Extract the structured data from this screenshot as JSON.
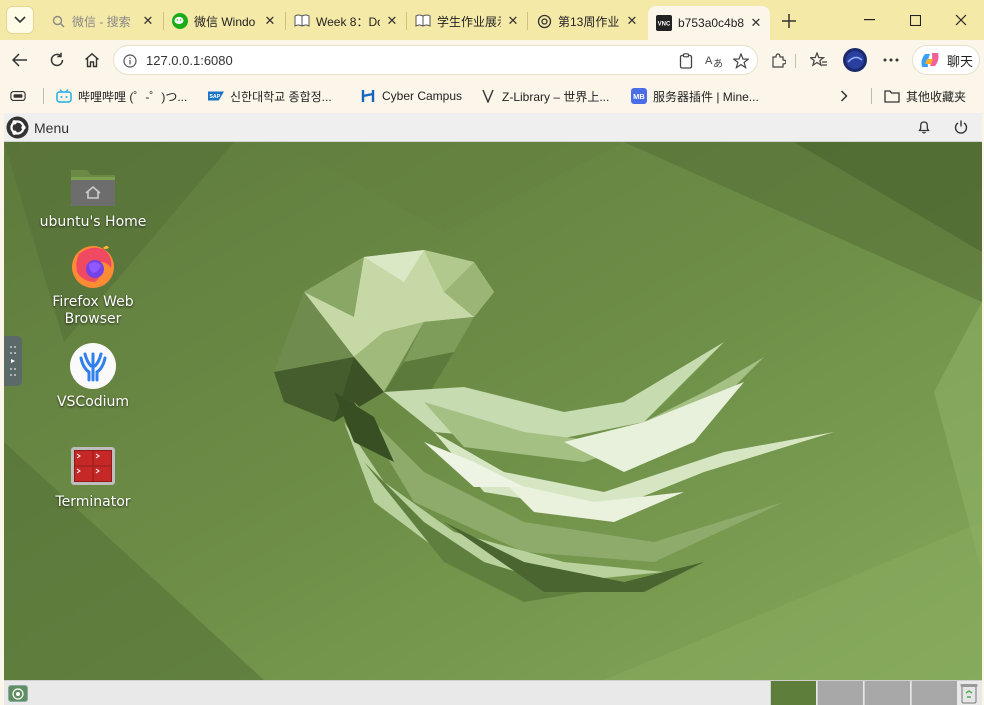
{
  "browser": {
    "tabs": [
      {
        "title": "微信 - 搜索",
        "icon": "search-icon",
        "faded": true
      },
      {
        "title": "微信 Windo",
        "icon": "wechat-icon"
      },
      {
        "title": "Week 8：Do",
        "icon": "book-icon"
      },
      {
        "title": "学生作业展示",
        "icon": "book-icon"
      },
      {
        "title": "第13周作业",
        "icon": "chatgpt-icon"
      },
      {
        "title": "b753a0c4b8",
        "icon": "vnc-icon",
        "active": true
      }
    ],
    "address": {
      "url": "127.0.0.1:6080"
    },
    "chat_label": "聊天",
    "bookmarks": [
      {
        "label": "哔哩哔哩 (゜-゜)つ...",
        "icon": "bilibili-icon"
      },
      {
        "label": "신한대학교 종합정...",
        "icon": "sap-icon"
      },
      {
        "label": "Cyber Campus",
        "icon": "cybercampus-icon"
      },
      {
        "label": "Z-Library – 世界上...",
        "icon": "zlibrary-icon"
      },
      {
        "label": "服务器插件 | Mine...",
        "icon": "mb-icon"
      }
    ],
    "other_bookmarks": "其他收藏夹",
    "mb_badge": "MB",
    "vnc_badge": "VNC",
    "sap_badge": "SAP"
  },
  "desktop": {
    "menu_label": "Menu",
    "icons": [
      {
        "label": "ubuntu's Home",
        "icon": "home-folder-icon"
      },
      {
        "label": "Firefox Web Browser",
        "icon": "firefox-icon"
      },
      {
        "label": "VSCodium",
        "icon": "vscodium-icon"
      },
      {
        "label": "Terminator",
        "icon": "terminator-icon"
      }
    ],
    "workspaces": 4,
    "active_workspace": 1,
    "colors": {
      "wallpaper": "#6f8f4a",
      "panel": "#efefef"
    }
  }
}
